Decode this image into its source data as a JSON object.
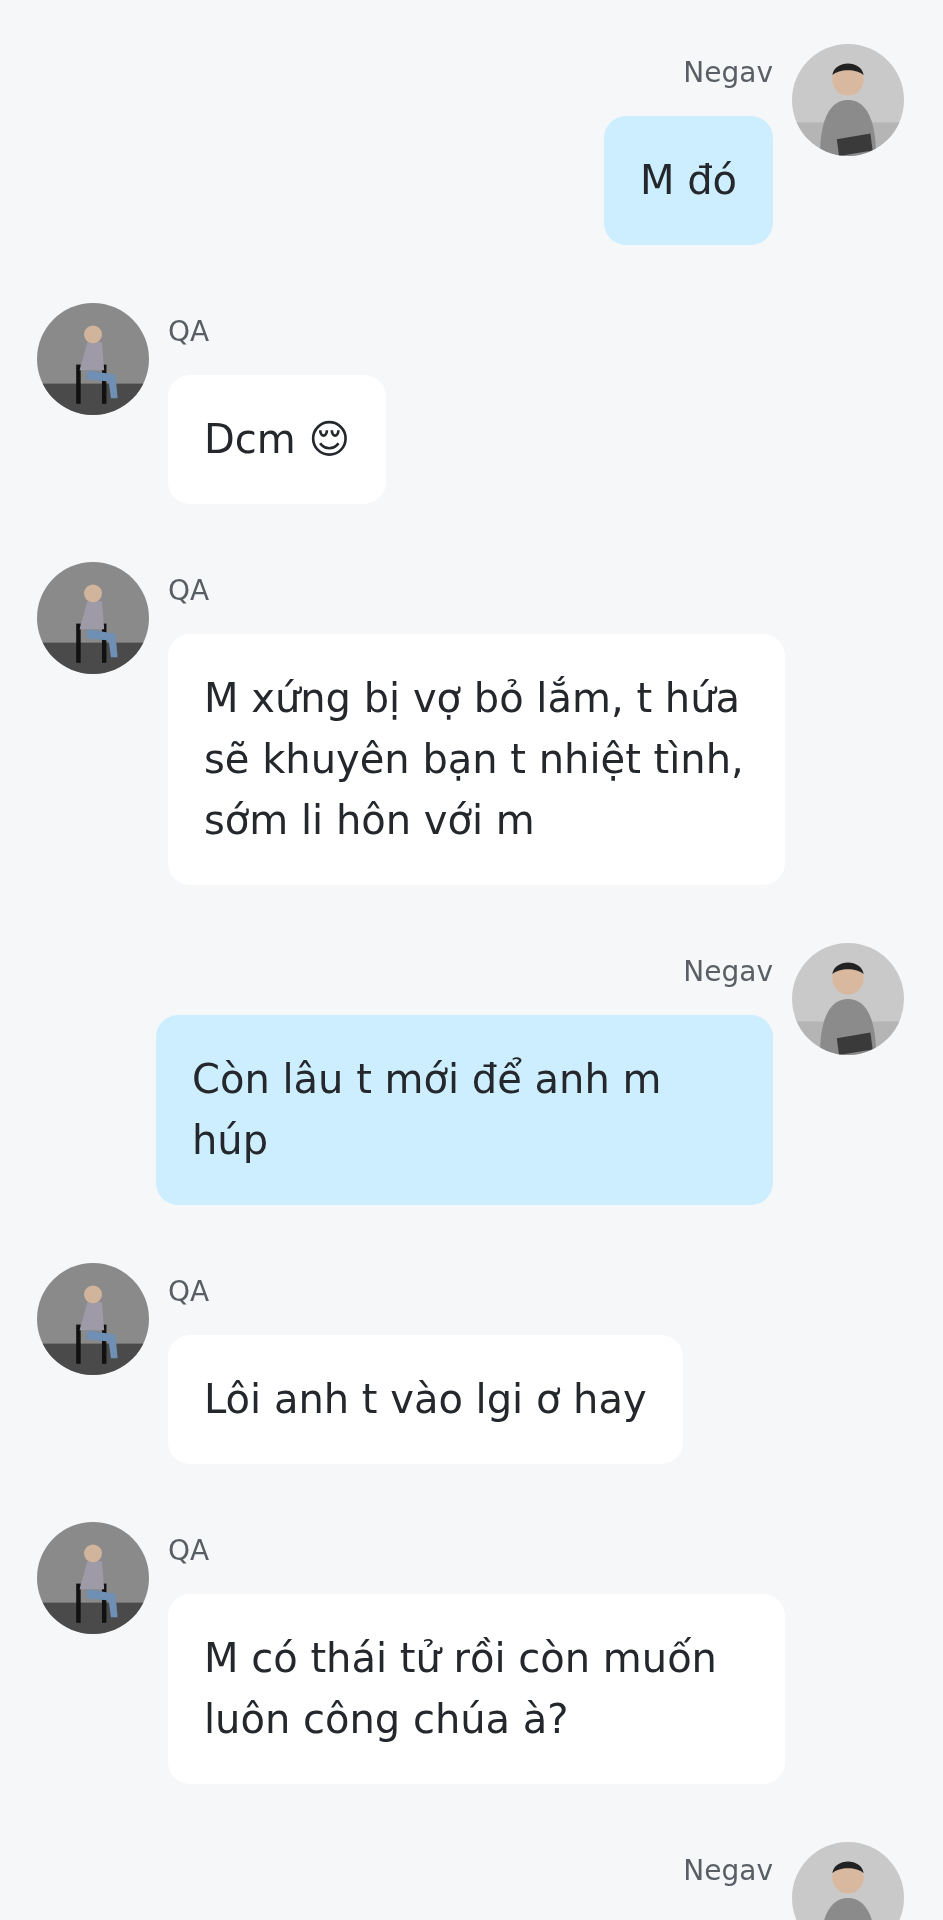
{
  "messages": [
    {
      "sender": "Negav",
      "outgoing": true,
      "text": "M đó"
    },
    {
      "sender": "QA",
      "outgoing": false,
      "text": "Dcm 😌"
    },
    {
      "sender": "QA",
      "outgoing": false,
      "text": "M xứng bị vợ bỏ lắm, t hứa sẽ khuyên bạn t nhiệt tình, sớm li hôn với m"
    },
    {
      "sender": "Negav",
      "outgoing": true,
      "text": "Còn lâu t mới để anh m húp"
    },
    {
      "sender": "QA",
      "outgoing": false,
      "text": "Lôi anh t vào lgi ơ hay"
    },
    {
      "sender": "QA",
      "outgoing": false,
      "text": "M có thái tử rồi còn muốn luôn công chúa à?"
    },
    {
      "sender": "Negav",
      "outgoing": true
    }
  ]
}
